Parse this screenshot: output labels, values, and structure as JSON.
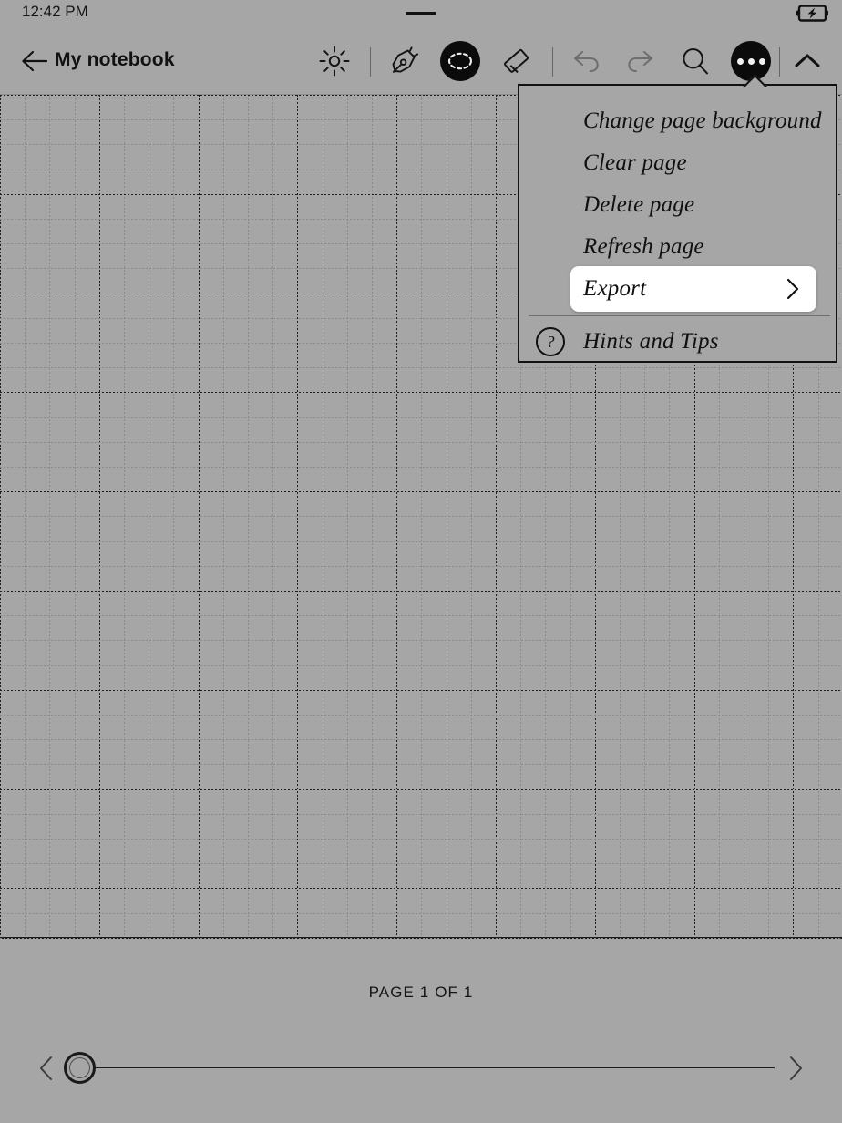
{
  "status_bar": {
    "time": "12:42 PM",
    "battery_icon": "battery-charging-icon",
    "notch_icon": "notch-indicator"
  },
  "toolbar": {
    "back_icon": "back-arrow-icon",
    "title": "My notebook",
    "tools": [
      {
        "name": "brightness",
        "icon": "sun-brightness-icon",
        "state": "enabled"
      },
      {
        "name": "pen",
        "icon": "fountain-pen-icon",
        "state": "enabled"
      },
      {
        "name": "selection",
        "icon": "lasso-selection-icon",
        "state": "active"
      },
      {
        "name": "eraser",
        "icon": "eraser-icon",
        "state": "enabled"
      },
      {
        "name": "undo",
        "icon": "undo-arrow-icon",
        "state": "disabled"
      },
      {
        "name": "redo",
        "icon": "redo-arrow-icon",
        "state": "disabled"
      },
      {
        "name": "search",
        "icon": "magnifier-icon",
        "state": "enabled"
      },
      {
        "name": "more",
        "icon": "ellipsis-icon",
        "state": "active"
      },
      {
        "name": "collapse",
        "icon": "chevron-up-icon",
        "state": "enabled"
      }
    ]
  },
  "more_menu": {
    "items": [
      {
        "label": "Change page background",
        "highlighted": false,
        "has_submenu": false
      },
      {
        "label": "Clear page",
        "highlighted": false,
        "has_submenu": false
      },
      {
        "label": "Delete page",
        "highlighted": false,
        "has_submenu": false
      },
      {
        "label": "Refresh page",
        "highlighted": false,
        "has_submenu": false
      },
      {
        "label": "Export",
        "highlighted": true,
        "has_submenu": true
      }
    ],
    "footer_item": {
      "label": "Hints and Tips",
      "icon": "question-mark-icon",
      "glyph": "?"
    },
    "submenu_chevron_icon": "chevron-right-icon"
  },
  "canvas": {
    "background_type": "dotted-grid"
  },
  "footer": {
    "page_indicator": "PAGE 1 OF 1",
    "prev_icon": "chevron-left-icon",
    "next_icon": "chevron-right-icon",
    "slider_value": 1,
    "slider_min": 1,
    "slider_max": 1
  },
  "colors": {
    "background": "#a6a6a6",
    "ink": "#111111",
    "highlight": "#ffffff",
    "disabled": "#6f6f6f"
  }
}
